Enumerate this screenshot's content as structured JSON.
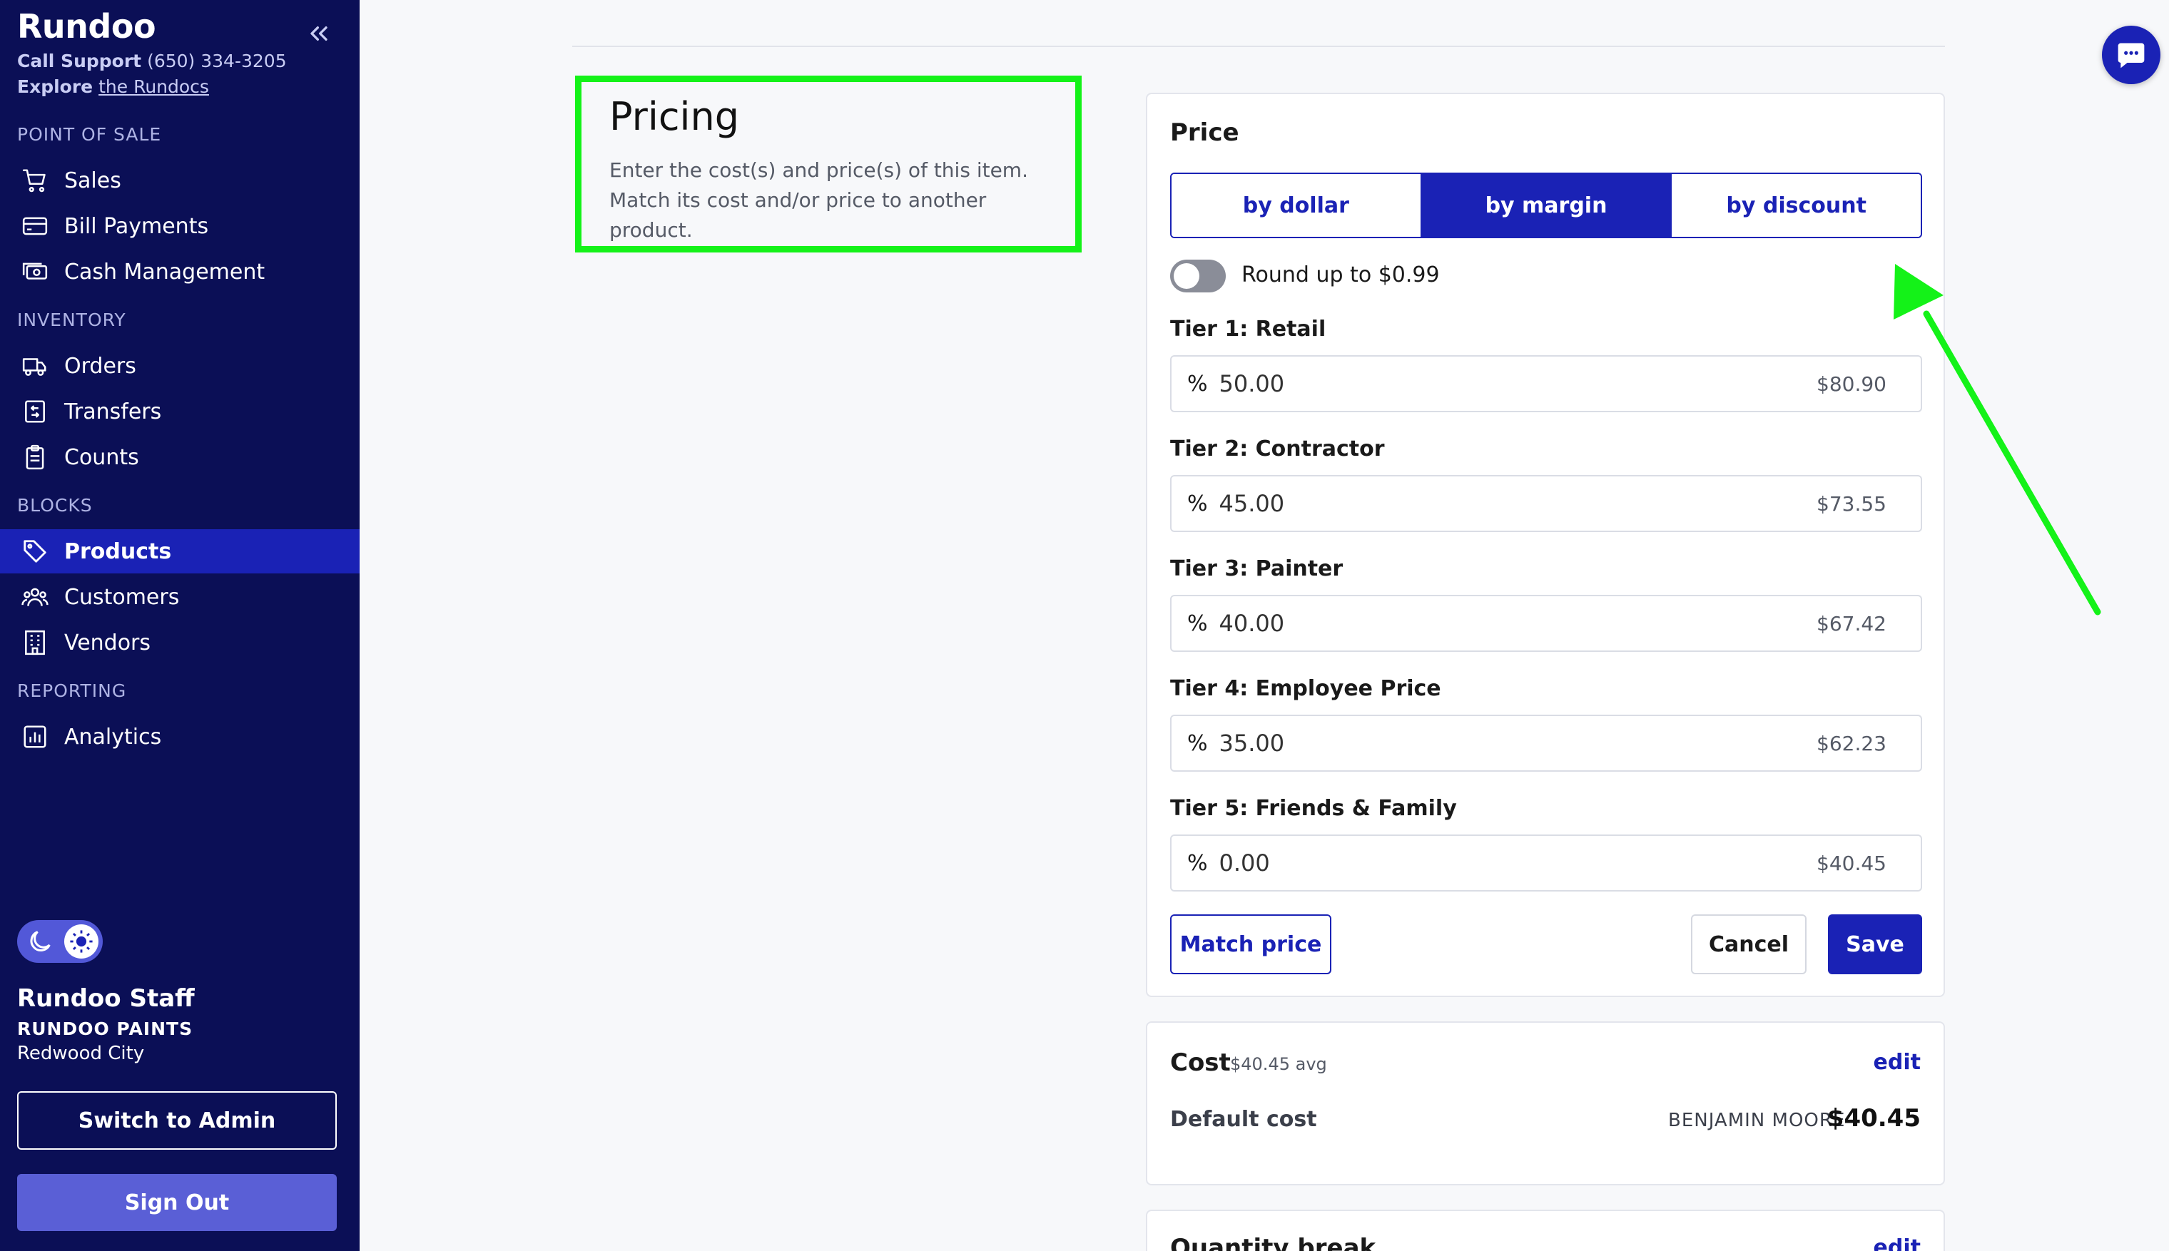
{
  "sidebar": {
    "brand": "Rundoo",
    "support_label": "Call Support",
    "support_phone": "(650) 334-3205",
    "explore_label": "Explore",
    "explore_link": "the Rundocs",
    "sections": {
      "pos": "POINT OF SALE",
      "inventory": "INVENTORY",
      "blocks": "BLOCKS",
      "reporting": "REPORTING"
    },
    "items": {
      "sales": "Sales",
      "bill_payments": "Bill Payments",
      "cash_management": "Cash Management",
      "orders": "Orders",
      "transfers": "Transfers",
      "counts": "Counts",
      "products": "Products",
      "customers": "Customers",
      "vendors": "Vendors",
      "analytics": "Analytics"
    },
    "user": {
      "name": "Rundoo Staff",
      "store": "RUNDOO PAINTS",
      "location": "Redwood City"
    },
    "switch_admin": "Switch to Admin",
    "sign_out": "Sign Out"
  },
  "main": {
    "section_title": "Pricing",
    "section_desc_line1": "Enter the cost(s) and price(s) of this item.",
    "section_desc_line2": "Match its cost and/or price to another product.",
    "price_card": {
      "title": "Price",
      "modes": [
        "by dollar",
        "by margin",
        "by discount"
      ],
      "active_mode": "by margin",
      "round_label": "Round up to $0.99",
      "round_enabled": false,
      "tiers": [
        {
          "label": "Tier 1: Retail",
          "symbol": "%",
          "value": "50.00",
          "computed": "$80.90"
        },
        {
          "label": "Tier 2: Contractor",
          "symbol": "%",
          "value": "45.00",
          "computed": "$73.55"
        },
        {
          "label": "Tier 3: Painter",
          "symbol": "%",
          "value": "40.00",
          "computed": "$67.42"
        },
        {
          "label": "Tier 4: Employee Price",
          "symbol": "%",
          "value": "35.00",
          "computed": "$62.23"
        },
        {
          "label": "Tier 5: Friends & Family",
          "symbol": "%",
          "value": "0.00",
          "computed": "$40.45"
        }
      ],
      "match_price": "Match price",
      "cancel": "Cancel",
      "save": "Save"
    },
    "cost_card": {
      "title": "Cost",
      "avg": "$40.45 avg",
      "edit": "edit",
      "default_label": "Default cost",
      "vendor": "BENJAMIN MOORE",
      "value": "$40.45"
    },
    "qty_card": {
      "title": "Quantity break",
      "edit": "edit"
    }
  },
  "colors": {
    "sidebar_bg": "#0b0f56",
    "accent": "#1a22b5",
    "highlight": "#14f218"
  }
}
